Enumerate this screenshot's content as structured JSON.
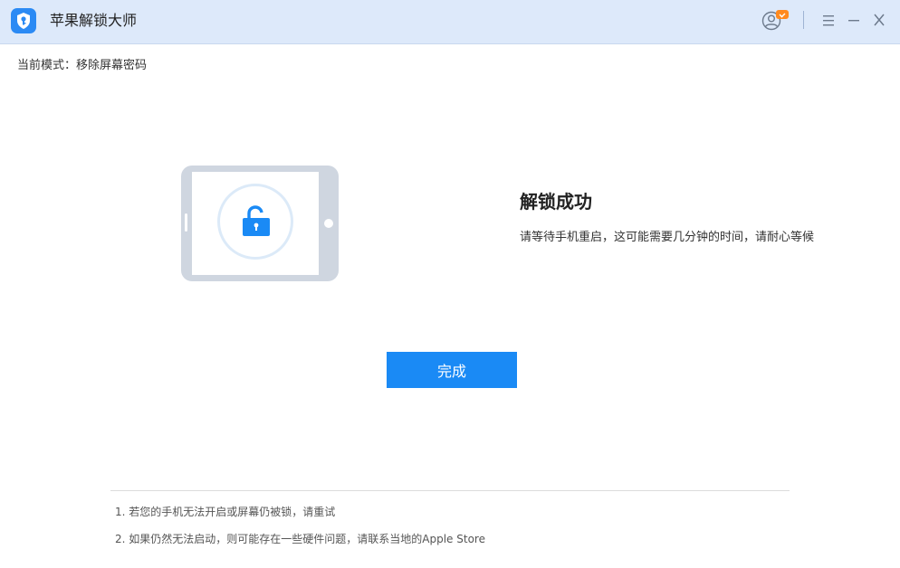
{
  "window": {
    "title": "苹果解锁大师"
  },
  "header": {
    "mode_label": "当前模式：移除屏幕密码"
  },
  "result": {
    "title": "解锁成功",
    "description": "请等待手机重启，这可能需要几分钟的时间，请耐心等候"
  },
  "actions": {
    "done_label": "完成"
  },
  "notes": [
    "1. 若您的手机无法开启或屏幕仍被锁，请重试",
    "2. 如果仍然无法启动，则可能存在一些硬件问题，请联系当地的Apple Store"
  ],
  "icons": {
    "app_logo": "shield-key-icon",
    "user": "user-vip-icon",
    "menu": "menu-icon",
    "minimize": "minimize-icon",
    "close": "close-icon",
    "unlock": "unlocked-padlock-icon"
  },
  "colors": {
    "accent": "#1a8af5",
    "titlebar_bg": "#dde9fa",
    "tablet_frame": "#cfd6e0"
  }
}
